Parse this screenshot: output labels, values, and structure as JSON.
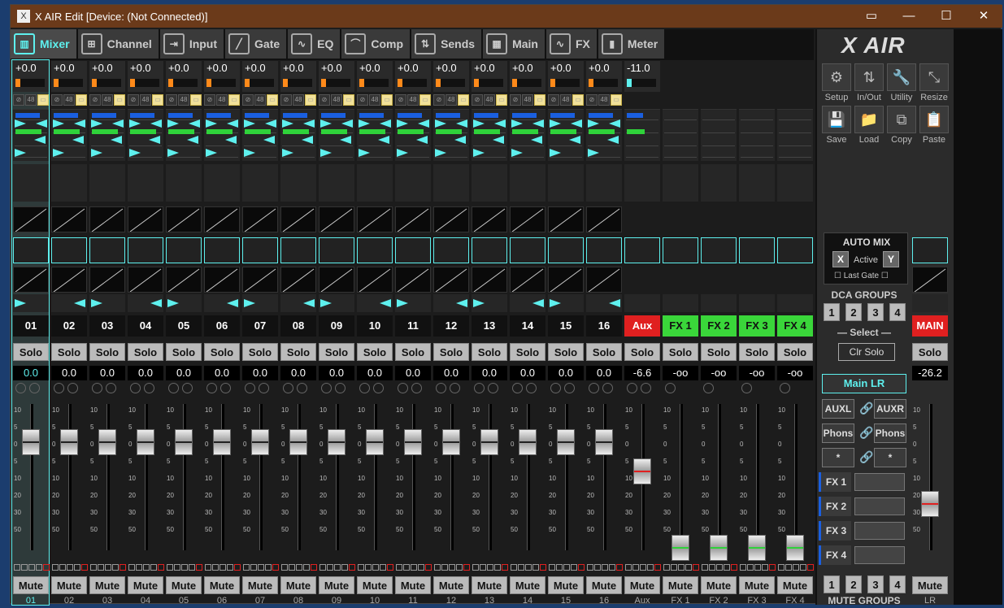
{
  "window": {
    "title": "X AIR Edit [Device: (Not Connected)]"
  },
  "tabs": [
    {
      "label": "Mixer",
      "icon": "mixer-icon"
    },
    {
      "label": "Channel",
      "icon": "channel-icon"
    },
    {
      "label": "Input",
      "icon": "input-icon"
    },
    {
      "label": "Gate",
      "icon": "gate-icon"
    },
    {
      "label": "EQ",
      "icon": "eq-icon"
    },
    {
      "label": "Comp",
      "icon": "comp-icon"
    },
    {
      "label": "Sends",
      "icon": "sends-icon"
    },
    {
      "label": "Main",
      "icon": "main-icon"
    },
    {
      "label": "FX",
      "icon": "fx-icon"
    },
    {
      "label": "Meter",
      "icon": "meter-icon"
    }
  ],
  "channels": [
    {
      "name": "01",
      "gain": "+0.0",
      "level": "0.0",
      "foot": "01"
    },
    {
      "name": "02",
      "gain": "+0.0",
      "level": "0.0",
      "foot": "02"
    },
    {
      "name": "03",
      "gain": "+0.0",
      "level": "0.0",
      "foot": "03"
    },
    {
      "name": "04",
      "gain": "+0.0",
      "level": "0.0",
      "foot": "04"
    },
    {
      "name": "05",
      "gain": "+0.0",
      "level": "0.0",
      "foot": "05"
    },
    {
      "name": "06",
      "gain": "+0.0",
      "level": "0.0",
      "foot": "06"
    },
    {
      "name": "07",
      "gain": "+0.0",
      "level": "0.0",
      "foot": "07"
    },
    {
      "name": "08",
      "gain": "+0.0",
      "level": "0.0",
      "foot": "08"
    },
    {
      "name": "09",
      "gain": "+0.0",
      "level": "0.0",
      "foot": "09"
    },
    {
      "name": "10",
      "gain": "+0.0",
      "level": "0.0",
      "foot": "10"
    },
    {
      "name": "11",
      "gain": "+0.0",
      "level": "0.0",
      "foot": "11"
    },
    {
      "name": "12",
      "gain": "+0.0",
      "level": "0.0",
      "foot": "12"
    },
    {
      "name": "13",
      "gain": "+0.0",
      "level": "0.0",
      "foot": "13"
    },
    {
      "name": "14",
      "gain": "+0.0",
      "level": "0.0",
      "foot": "14"
    },
    {
      "name": "15",
      "gain": "+0.0",
      "level": "0.0",
      "foot": "15"
    },
    {
      "name": "16",
      "gain": "+0.0",
      "level": "0.0",
      "foot": "16"
    }
  ],
  "aux": {
    "name": "Aux",
    "gain": "-11.0",
    "level": "-6.6",
    "foot": "Aux"
  },
  "fx_returns": [
    {
      "name": "FX 1",
      "level": "-oo",
      "foot": "FX 1"
    },
    {
      "name": "FX 2",
      "level": "-oo",
      "foot": "FX 2"
    },
    {
      "name": "FX 3",
      "level": "-oo",
      "foot": "FX 3"
    },
    {
      "name": "FX 4",
      "level": "-oo",
      "foot": "FX 4"
    }
  ],
  "main": {
    "name": "MAIN",
    "level": "-26.2",
    "foot": "LR"
  },
  "labels": {
    "solo": "Solo",
    "mute": "Mute",
    "phantom": "48"
  },
  "scale": [
    "10",
    "5",
    "0",
    "5",
    "10",
    "20",
    "30",
    "50"
  ],
  "tools": [
    {
      "label": "Setup",
      "icon": "gear-icon"
    },
    {
      "label": "In/Out",
      "icon": "arrows-icon"
    },
    {
      "label": "Utility",
      "icon": "wrench-icon"
    },
    {
      "label": "Resize",
      "icon": "resize-icon"
    },
    {
      "label": "Save",
      "icon": "save-icon"
    },
    {
      "label": "Load",
      "icon": "folder-icon"
    },
    {
      "label": "Copy",
      "icon": "copy-icon"
    },
    {
      "label": "Paste",
      "icon": "paste-icon"
    }
  ],
  "logo": "X AIR",
  "automix": {
    "title": "AUTO MIX",
    "x": "X",
    "y": "Y",
    "active": "Active",
    "last_gate": "Last Gate"
  },
  "dca": {
    "title": "DCA GROUPS",
    "numbers": [
      "1",
      "2",
      "3",
      "4"
    ],
    "select": "Select",
    "clr_solo": "Clr Solo"
  },
  "bus": {
    "main_lr": "Main LR",
    "auxl": "AUXL",
    "auxr": "AUXR",
    "phons_l": "Phons",
    "phons_r": "Phons",
    "star_l": "*",
    "star_r": "*"
  },
  "fx_slots": [
    "FX 1",
    "FX 2",
    "FX 3",
    "FX 4"
  ],
  "mute_groups": {
    "title": "MUTE GROUPS",
    "numbers": [
      "1",
      "2",
      "3",
      "4"
    ]
  },
  "colors": {
    "accent": "#5ef0ee",
    "aux": "#e02020",
    "fx": "#3ad63a",
    "gain": "#ff8a1a",
    "titlebar": "#6b3a1a"
  }
}
